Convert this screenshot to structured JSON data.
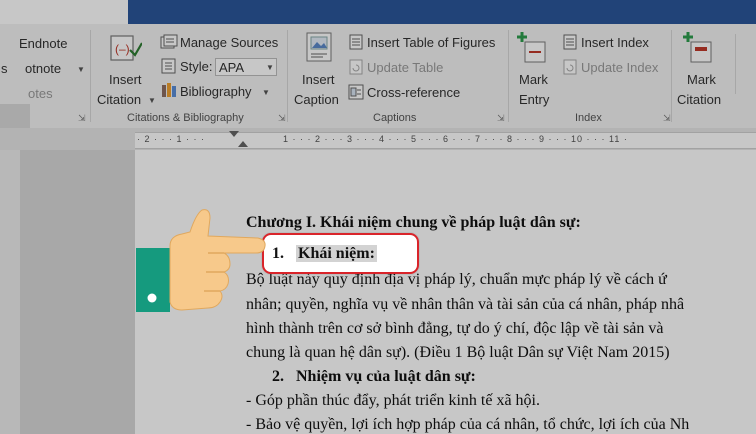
{
  "ribbon": {
    "footnotes": {
      "endnote": "Endnote",
      "footnote": "otnote",
      "footnote_prefix": "s",
      "notes": "otes"
    },
    "citations": {
      "insert_citation_line1": "Insert",
      "insert_citation_line2": "Citation",
      "manage_sources": "Manage Sources",
      "style_label": "Style:",
      "style_value": "APA",
      "bibliography": "Bibliography",
      "group_label": "Citations & Bibliography"
    },
    "captions": {
      "insert_caption_line1": "Insert",
      "insert_caption_line2": "Caption",
      "insert_table_of_figures": "Insert Table of Figures",
      "update_table": "Update Table",
      "cross_reference": "Cross-reference",
      "group_label": "Captions"
    },
    "index": {
      "mark_entry_line1": "Mark",
      "mark_entry_line2": "Entry",
      "insert_index": "Insert Index",
      "update_index": "Update Index",
      "group_label": "Index"
    },
    "table_of_authorities": {
      "mark_citation_line1": "Mark",
      "mark_citation_line2": "Citation"
    }
  },
  "ruler": {
    "left_text": "· 2 · · · 1 · · ·",
    "right_text": "1 · · · 2 · · · 3 · · · 4 · · · 5 · · · 6 · · · 7 · · · 8 · · · 9 · · · 10 · · · 11 ·"
  },
  "document": {
    "chapter_heading": "Chương I. Khái niệm chung về pháp luật dân sự:",
    "item1_number": "1.",
    "item1_title": "Khái niệm:",
    "para_line1": "Bộ luật này quy định địa vị pháp lý, chuẩn mực pháp lý về cách ứ",
    "para_line2": "nhân; quyền, nghĩa vụ về nhân thân và tài sản của cá nhân, pháp nhâ",
    "para_line3": "hình thành trên cơ sở bình đẳng, tự do ý chí, độc lập về tài sản và",
    "para_line4": "chung là quan hệ dân sự). (Điều 1 Bộ luật Dân sự Việt Nam 2015)",
    "item2_number": "2.",
    "item2_title": "Nhiệm vụ của luật dân sự:",
    "bullet1": "- Góp phần thúc đẩy, phát triển kinh tế xã hội.",
    "bullet2": "- Bảo vệ quyền, lợi ích hợp pháp của cá nhân, tổ chức, lợi ích của Nh"
  },
  "colors": {
    "title_bar": "#2b579a",
    "highlight_border": "#d9242a",
    "hand_skin": "#f7c98b",
    "cuff": "#159a7e"
  },
  "icons": [
    "insert-citation-icon",
    "manage-sources-icon",
    "style-icon",
    "bibliography-icon",
    "insert-caption-icon",
    "table-of-figures-icon",
    "update-table-icon",
    "cross-reference-icon",
    "mark-entry-icon",
    "insert-index-icon",
    "update-index-icon",
    "mark-citation-icon",
    "pointing-hand-icon"
  ]
}
